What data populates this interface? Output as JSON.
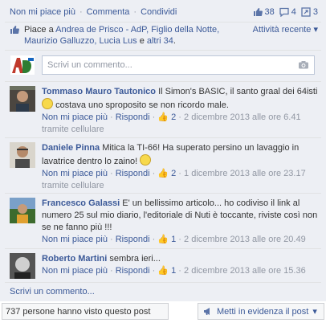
{
  "actions": {
    "unlike": "Non mi piace più",
    "comment": "Commenta",
    "share": "Condividi",
    "separator": "·"
  },
  "stats": {
    "likes": "38",
    "comments": "4",
    "shares": "3"
  },
  "likes_summary": {
    "prefix": "Piace a",
    "names": "Andrea de Prisco - AdP, Figlio della Notte, Maurizio Galluzzo, Lucia Lus",
    "conjunction": "e",
    "others": "altri 34",
    "suffix": ".",
    "activity": "Attività recente"
  },
  "composer": {
    "placeholder": "Scrivi un commento..."
  },
  "comments": [
    {
      "author": "Tommaso Mauro Tautonico",
      "text_before": "Il Simon's BASIC, il santo graal dei 64isti",
      "text_after": "costava uno sproposito se non ricordo male.",
      "unlike": "Non mi piace più",
      "reply": "Rispondi",
      "likes": "2",
      "time": "2 dicembre 2013 alle ore 6.41",
      "source": "tramite cellulare"
    },
    {
      "author": "Daniele Pinna",
      "text_before": "Mitica la TI-66!",
      "text_after": "Ha superato persino un lavaggio in lavatrice dentro lo zaino!",
      "unlike": "Non mi piace più",
      "reply": "Rispondi",
      "likes": "2",
      "time": "1 dicembre 2013 alle ore 23.17",
      "source": "tramite cellulare"
    },
    {
      "author": "Francesco Galassi",
      "text_before": "E' un bellissimo articolo... ho codiviso il link al numero 25 sul mio diario, l'editoriale di Nuti è toccante, riviste così non se ne fanno più !!!",
      "unlike": "Non mi piace più",
      "reply": "Rispondi",
      "likes": "1",
      "time": "2 dicembre 2013 alle ore 20.49"
    },
    {
      "author": "Roberto Martini",
      "text_before": "sembra ieri...",
      "unlike": "Non mi piace più",
      "reply": "Rispondi",
      "likes": "1",
      "time": "2 dicembre 2013 alle ore 15.36"
    }
  ],
  "write_more": "Scrivi un commento...",
  "footer": {
    "seen": "737 persone hanno visto questo post",
    "promote": "Metti in evidenza il post"
  }
}
